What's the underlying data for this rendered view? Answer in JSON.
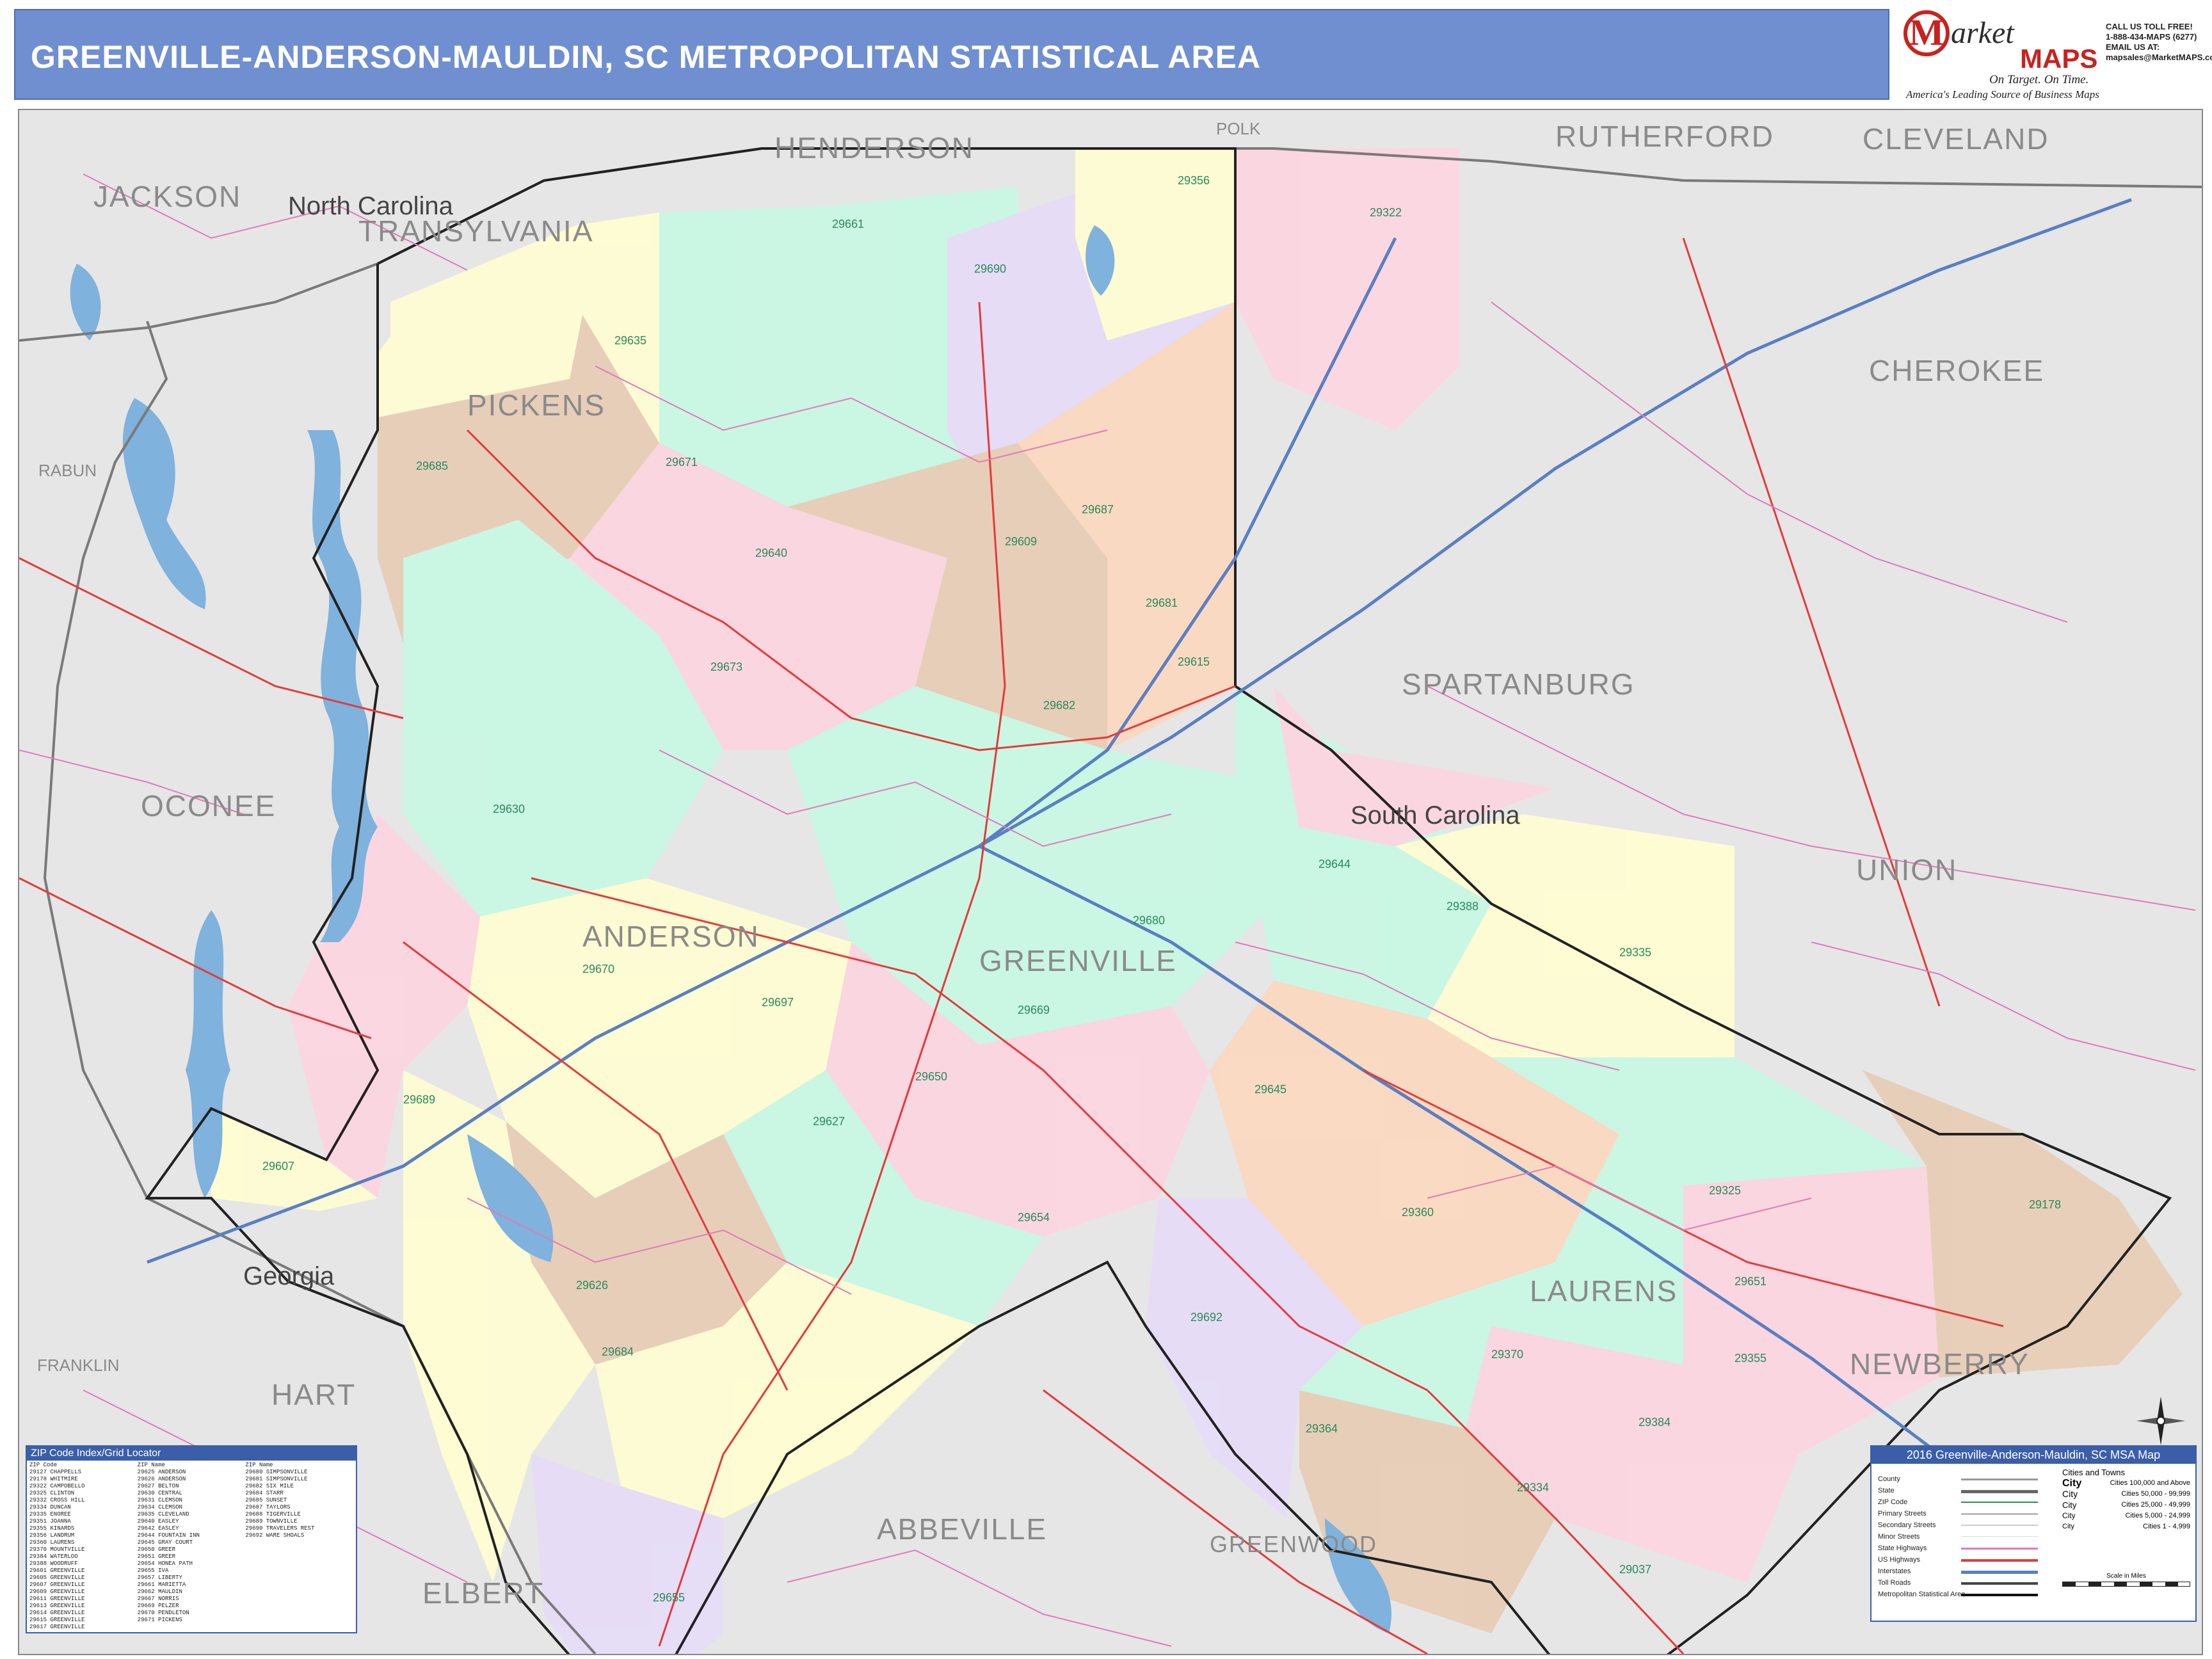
{
  "title": "GREENVILLE-ANDERSON-MAULDIN, SC METROPOLITAN STATISTICAL AREA",
  "brand": {
    "logo_m": "M",
    "market": "arket",
    "maps": "MAPS",
    "slogan": "On Target. On Time.",
    "tag": "America's Leading Source of Business Maps"
  },
  "contact": {
    "line1": "CALL US TOLL FREE!",
    "line2": "1-888-434-MAPS (6277)",
    "line3": "EMAIL US AT:",
    "line4": "mapsales@MarketMAPS.com"
  },
  "counties": {
    "henderson": "HENDERSON",
    "rutherford": "RUTHERFORD",
    "cleveland": "CLEVELAND",
    "jackson": "JACKSON",
    "transylvania": "TRANSYLVANIA",
    "pickens": "PICKENS",
    "cherokee": "CHEROKEE",
    "rabun": "RABUN",
    "oconee": "OCONEE",
    "spartanburg": "SPARTANBURG",
    "union": "UNION",
    "anderson": "ANDERSON",
    "greenville": "GREENVILLE",
    "laurens": "LAURENS",
    "newberry": "NEWBERRY",
    "hart": "HART",
    "franklin": "FRANKLIN",
    "abbeville": "ABBEVILLE",
    "greenwood": "GREENWOOD",
    "elbert": "ELBERT",
    "polk": "POLK"
  },
  "states": {
    "nc": "North Carolina",
    "sc": "South Carolina",
    "ga": "Georgia"
  },
  "zips": [
    "29356",
    "29322",
    "29661",
    "29690",
    "29635",
    "29685",
    "29671",
    "29687",
    "29609",
    "29640",
    "29615",
    "29630",
    "29644",
    "29388",
    "29335",
    "29680",
    "29670",
    "29697",
    "29669",
    "29645",
    "29689",
    "29627",
    "29654",
    "29360",
    "29325",
    "29178",
    "29364",
    "29684",
    "29626",
    "29692",
    "29370",
    "29355",
    "29384",
    "29334",
    "29037",
    "29655",
    "29681",
    "29682",
    "29673",
    "29651",
    "29650",
    "29607"
  ],
  "zip_index": {
    "header": "ZIP Code Index/Grid Locator",
    "col1": [
      "ZIP Code",
      "29127 CHAPPELLS",
      "29178 WHITMIRE",
      "29322 CAMPOBELLO",
      "29325 CLINTON",
      "29332 CROSS HILL",
      "29334 DUNCAN",
      "29335 ENOREE",
      "29351 JOANNA",
      "29355 KINARDS",
      "29356 LANDRUM",
      "29360 LAURENS",
      "29370 MOUNTVILLE",
      "29384 WATERLOO",
      "29388 WOODRUFF",
      "29601 GREENVILLE",
      "29605 GREENVILLE",
      "29607 GREENVILLE",
      "29609 GREENVILLE",
      "29611 GREENVILLE",
      "29613 GREENVILLE",
      "29614 GREENVILLE",
      "29615 GREENVILLE",
      "29617 GREENVILLE",
      "29621 ANDERSON",
      "29624 ANDERSON"
    ],
    "col2": [
      "ZIP Name",
      "29625 ANDERSON",
      "29626 ANDERSON",
      "29627 BELTON",
      "29630 CENTRAL",
      "29631 CLEMSON",
      "29634 CLEMSON",
      "29635 CLEVELAND",
      "29640 EASLEY",
      "29642 EASLEY",
      "29644 FOUNTAIN INN",
      "29645 GRAY COURT",
      "29650 GREER",
      "29651 GREER",
      "29654 HONEA PATH",
      "29655 IVA",
      "29657 LIBERTY",
      "29661 MARIETTA",
      "29662 MAULDIN",
      "29667 NORRIS",
      "29669 PELZER",
      "29670 PENDLETON",
      "29671 PICKENS",
      "29673 PIEDMONT"
    ],
    "col3": [
      "ZIP Name",
      "29680 SIMPSONVILLE",
      "29681 SIMPSONVILLE",
      "29682 SIX MILE",
      "29684 STARR",
      "29685 SUNSET",
      "29687 TAYLORS",
      "29688 TIGERVILLE",
      "29689 TOWNVILLE",
      "29690 TRAVELERS REST",
      "29692 WARE SHOALS",
      "29697 WILLIAMSTON"
    ]
  },
  "legend": {
    "header": "2016 Greenville-Anderson-Mauldin, SC MSA Map",
    "items": [
      "County",
      "State",
      "ZIP Code",
      "Primary Streets",
      "Secondary Streets",
      "Minor Streets",
      "State Highways",
      "US Highways",
      "Interstates",
      "Toll Roads",
      "Metropolitan Statistical Area"
    ],
    "cities_title": "Cities and Towns",
    "cities": [
      "City",
      "City",
      "City",
      "City",
      "City"
    ],
    "populations": [
      "Cities 100,000 and Above",
      "Cities 50,000 - 99,999",
      "Cities 25,000 - 49,999",
      "Cities 5,000 - 24,999",
      "Cities 1 - 4,999"
    ],
    "scale_label": "Scale in Miles"
  },
  "colors": {
    "header_bg": "#6f8fd1",
    "map_bg": "#e6e6e6",
    "zip_yellow": "#fffdd2",
    "zip_green": "#c9f7e4",
    "zip_pink": "#fcd6e0",
    "zip_purple": "#e6dcf7",
    "zip_tan": "#e8cdb7",
    "zip_peach": "#fbd9c0",
    "water": "#7fb2dc",
    "road_red": "#e33b3b",
    "road_pink": "#e07ab8"
  }
}
